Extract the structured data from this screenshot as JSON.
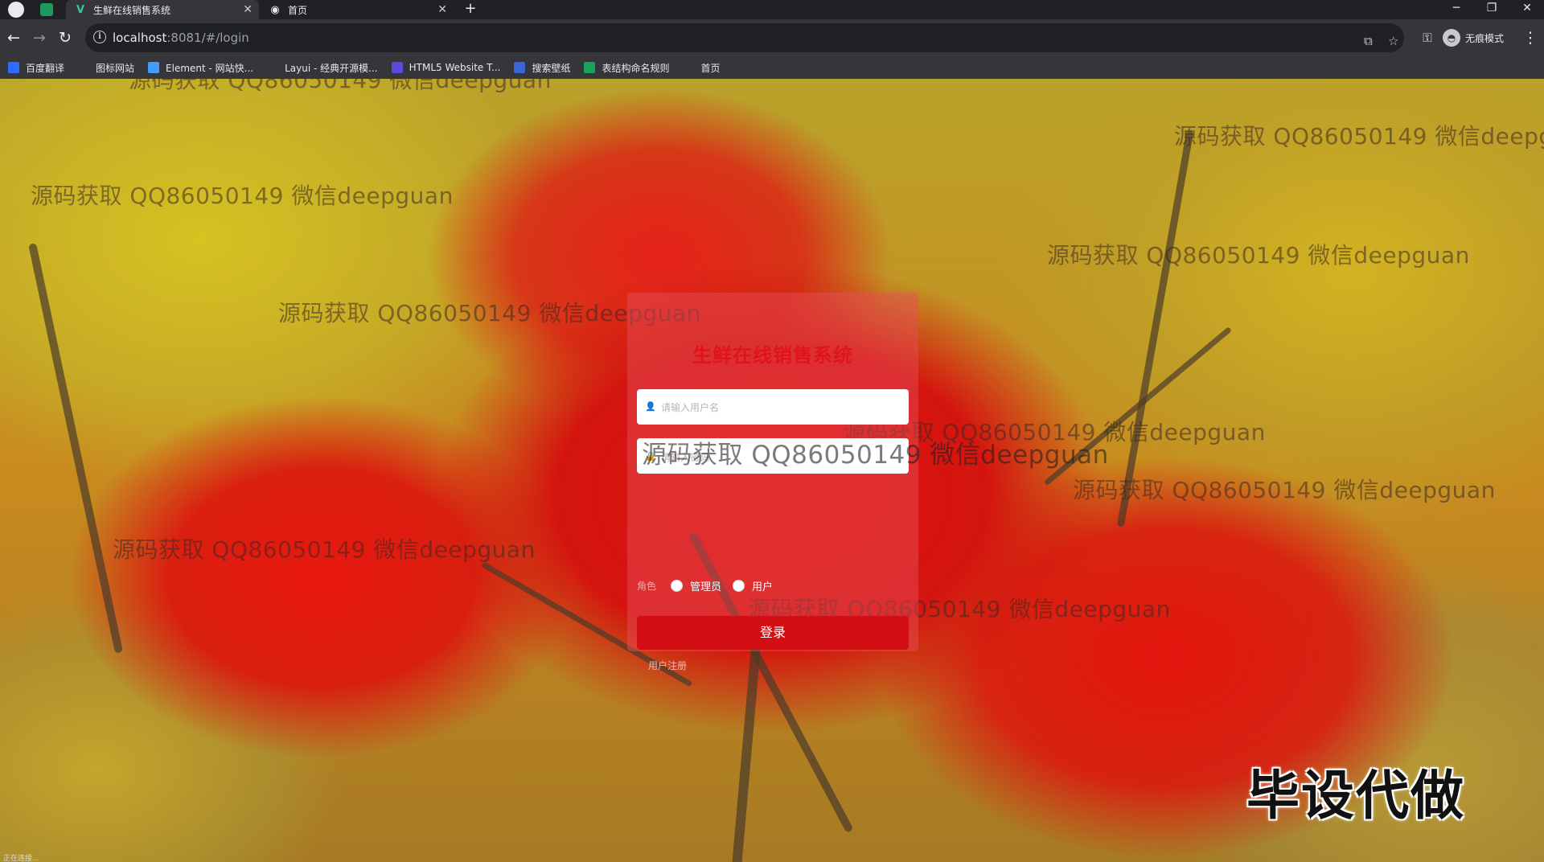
{
  "browser": {
    "tabs": [
      {
        "title": "生鲜在线销售系统",
        "active": true,
        "favicon": "vue-v-icon"
      },
      {
        "title": "首页",
        "active": false,
        "favicon": "globe-icon"
      }
    ],
    "new_tab_symbol": "+",
    "window_controls": {
      "minimize": "─",
      "restore": "❐",
      "close": "✕"
    },
    "address": {
      "host": "localhost",
      "rest": ":8081/#/login"
    },
    "profile_label": "无痕模式",
    "bookmarks": [
      {
        "label": "百度翻译",
        "icon": "translate-icon",
        "color": "#2f6bff"
      },
      {
        "label": "图标网站",
        "icon": "flag-icon",
        "color": "#35363a"
      },
      {
        "label": "Element - 网站快...",
        "icon": "element-hexagon-icon",
        "color": "#409eff"
      },
      {
        "label": "Layui - 经典开源模...",
        "icon": "layui-icon",
        "color": "#35363a"
      },
      {
        "label": "HTML5 Website T...",
        "icon": "html5-icon",
        "color": "#5a4bdc"
      },
      {
        "label": "搜索壁纸",
        "icon": "wallpaper-icon",
        "color": "#3a64d8"
      },
      {
        "label": "表结构命名规则",
        "icon": "table-icon",
        "color": "#19a35b"
      },
      {
        "label": "首页",
        "icon": "globe-icon",
        "color": "#35363a"
      }
    ]
  },
  "login": {
    "title": "生鲜在线销售系统",
    "username_placeholder": "请输入用户名",
    "password_placeholder": "请输入密码",
    "role_label": "角色",
    "roles": [
      "管理员",
      "用户"
    ],
    "submit_label": "登录",
    "register_link": "用户注册"
  },
  "watermark_text": "源码获取 QQ86050149 微信deepguan",
  "promo_text": "毕设代做",
  "status_text": "正在连接...",
  "colors": {
    "title_red": "#e0141a",
    "button_red": "#d40f14",
    "card_tint": "rgba(230,80,90,0.45)"
  }
}
